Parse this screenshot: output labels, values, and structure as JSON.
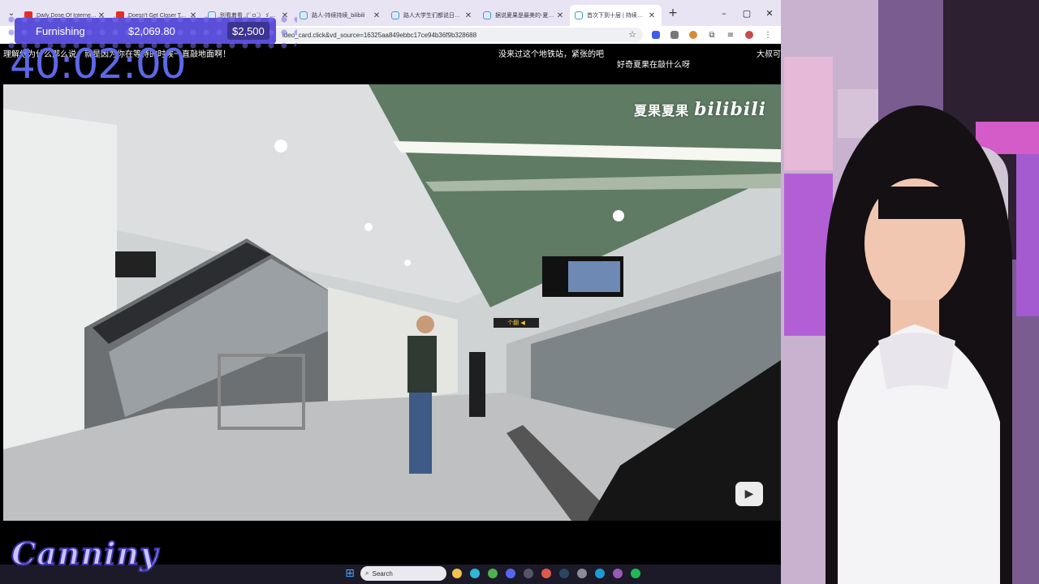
{
  "browser": {
    "tabs": [
      {
        "title": "Daily Dose Of Internet - Yo",
        "favicon": "youtube-icon",
        "active": false
      },
      {
        "title": "Doesn't Get Closer Than T",
        "favicon": "youtube-icon",
        "active": false
      },
      {
        "title": "别看着看（'`ㅁ`）ゞ二会~",
        "favicon": "bilibili-icon",
        "active": false
      },
      {
        "title": "路人-持续持续_bilibili",
        "favicon": "bilibili-icon",
        "active": false
      },
      {
        "title": "路人大学生们都说日吧 | 华",
        "favicon": "bilibili-icon",
        "active": false
      },
      {
        "title": "据说夏果是最美的-夏果夏果",
        "favicon": "bilibili-icon",
        "active": false
      },
      {
        "title": "首次下到十层 | 持续走到最",
        "favicon": "bilibili-icon",
        "active": true
      }
    ],
    "new_tab": "+",
    "window_controls": {
      "minimize": "–",
      "maximize": "▢",
      "close": "✕"
    },
    "address": "ideo_card.click&vd_source=16325aa849ebbc17ce94b36f9b328688"
  },
  "overlay": {
    "furnishing": {
      "label": "Furnishing",
      "amount": "$2,069.80",
      "goal": "$2,500"
    },
    "timer": "40:02:00",
    "danmaku": [
      "理解他为什么那么说，就是因为你在等待的时候一直敲地面啊！",
      "没来过这个地铁站，紧张的吧",
      "好奇夏果在敲什么呀",
      "大叔可"
    ],
    "logo_text": "Canniny"
  },
  "video": {
    "watermark_name": "夏果夏果",
    "watermark_logo": "bilibili",
    "sign_text": "个翻 ◀"
  },
  "taskbar": {
    "search_placeholder": "Search",
    "apps": [
      {
        "name": "file-explorer-icon",
        "color": "#f2c14e"
      },
      {
        "name": "edge-icon",
        "color": "#2fb6d9"
      },
      {
        "name": "chrome-icon",
        "color": "#4caf50"
      },
      {
        "name": "discord-icon",
        "color": "#5865f2"
      },
      {
        "name": "obs-icon",
        "color": "#555566"
      },
      {
        "name": "chrome-alt-icon",
        "color": "#e0584c"
      },
      {
        "name": "steam-icon",
        "color": "#2a475e"
      },
      {
        "name": "app-icon",
        "color": "#8a8a99"
      },
      {
        "name": "browser-icon",
        "color": "#1d9bd7"
      },
      {
        "name": "tool-icon",
        "color": "#9b59b6"
      },
      {
        "name": "spotify-icon",
        "color": "#1db954"
      }
    ]
  }
}
